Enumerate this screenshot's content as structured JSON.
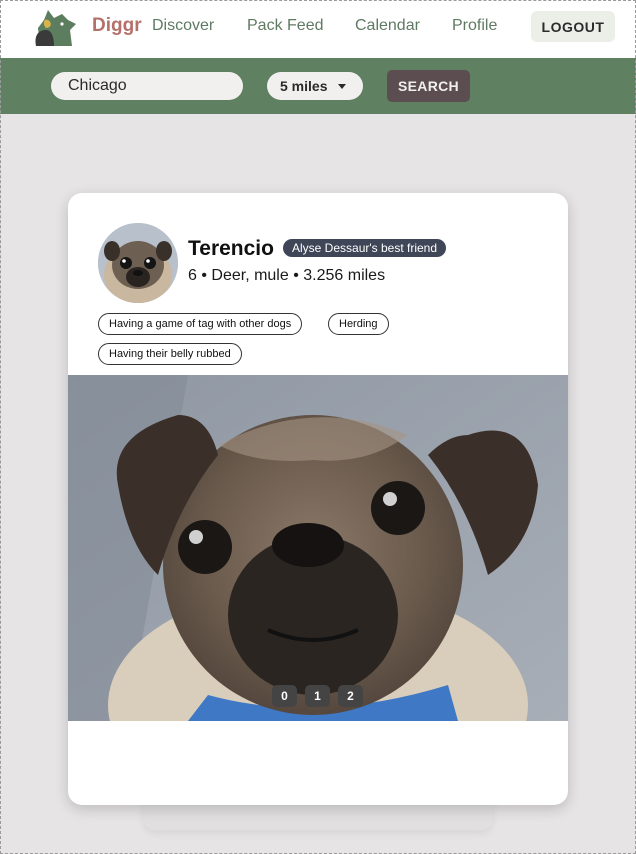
{
  "nav": {
    "brand": "Diggr",
    "links": [
      "Discover",
      "Pack Feed",
      "Calendar",
      "Profile"
    ],
    "logout": "LOGOUT"
  },
  "search": {
    "city_value": "Chicago",
    "distance": "5 miles",
    "button": "SEARCH"
  },
  "profile": {
    "name": "Terencio",
    "badge": "Alyse Dessaur's best friend",
    "meta": "6 • Deer, mule • 3.256 miles",
    "tags": [
      "Having a game of tag with other dogs",
      "Herding",
      "Having their belly rubbed"
    ],
    "photo_pager": [
      "0",
      "1",
      "2"
    ]
  },
  "colors": {
    "brand": "#b5706a",
    "nav_link": "#5f7a63",
    "search_bar": "#5f8162",
    "search_button": "#5c4d50",
    "badge": "#3f4657"
  }
}
